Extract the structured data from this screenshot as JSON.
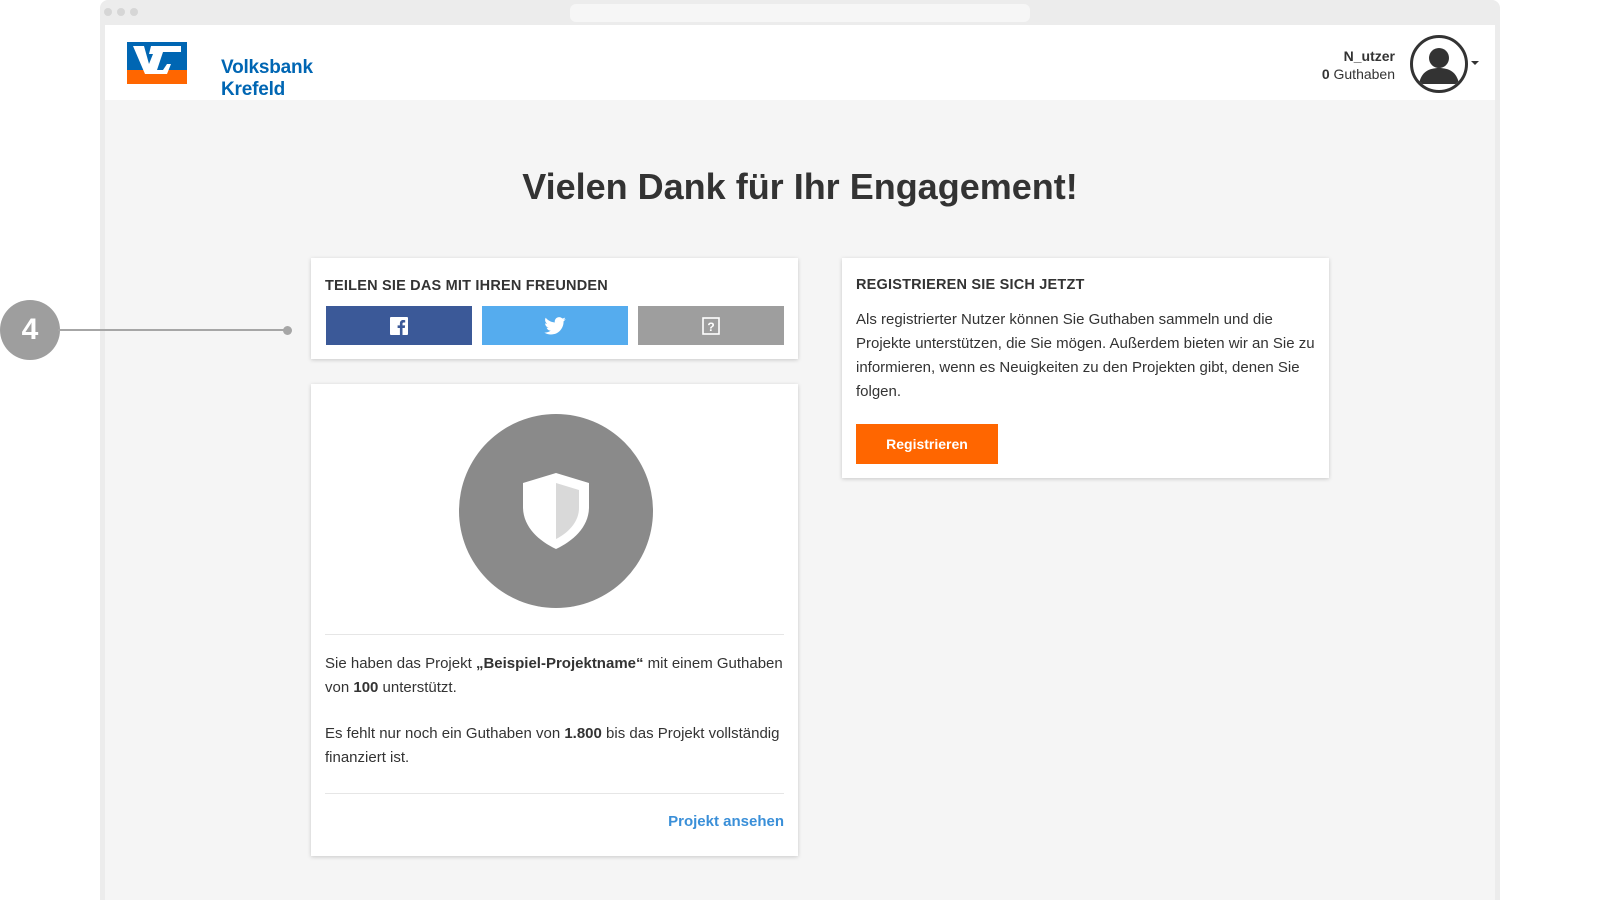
{
  "header": {
    "logo_line1": "Volksbank",
    "logo_line2": "Krefeld eG",
    "user_name": "N_utzer",
    "credit_amount": "0",
    "credit_label": "Guthaben"
  },
  "page": {
    "title": "Vielen Dank für Ihr Engagement!"
  },
  "share": {
    "heading": "TEILEN SIE DAS MIT IHREN FREUNDEN",
    "buttons": [
      {
        "icon": "facebook-icon",
        "color": "#3b5998"
      },
      {
        "icon": "twitter-icon",
        "color": "#55acee"
      },
      {
        "icon": "question-icon",
        "color": "#9e9e9e"
      }
    ]
  },
  "project": {
    "icon": "shield-icon",
    "text1_a": "Sie haben das Projekt ",
    "project_name": "„Beispiel-Projektname“",
    "text1_b": " mit einem Guthaben von ",
    "amount": "100",
    "text1_c": " unterstützt.",
    "text2_a": "Es fehlt nur noch ein Guthaben von ",
    "missing_amount": "1.800",
    "text2_b": " bis das Projekt vollständig finanziert ist.",
    "link_label": "Projekt ansehen"
  },
  "register": {
    "heading": "REGISTRIEREN SIE SICH JETZT",
    "text": "Als registrierter Nutzer können Sie Guthaben sammeln und die Projekte unterstützen, die Sie mögen. Außerdem bieten wir an Sie zu informieren, wenn es Neuigkeiten zu den Projekten gibt, denen Sie folgen.",
    "button_label": "Registrieren",
    "button_color": "#ff6600"
  },
  "annotation": {
    "number": "4"
  },
  "colors": {
    "brand_blue": "#0066b3",
    "brand_orange": "#ff6600",
    "link_blue": "#3a8fd8"
  }
}
